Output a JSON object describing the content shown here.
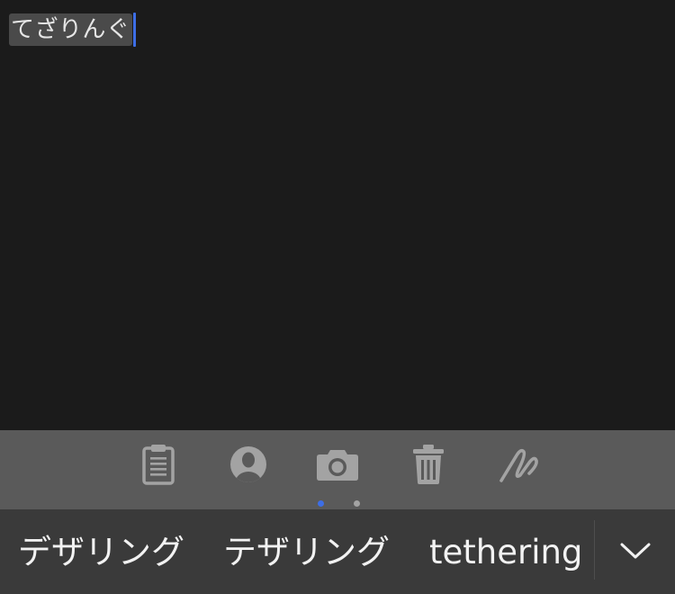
{
  "editor": {
    "composing_text": "てざりんぐ"
  },
  "toolbar": {
    "icons": [
      "clipboard-icon",
      "contact-icon",
      "camera-icon",
      "trash-icon",
      "handwriting-icon"
    ],
    "page_count": 2,
    "active_page": 1
  },
  "candidates": {
    "items": [
      "デザリング",
      "テザリング",
      "tethering"
    ],
    "expand_icon": "chevron-down-icon"
  },
  "colors": {
    "background": "#1b1b1b",
    "composing_highlight": "#4a4a4a",
    "caret": "#3d6ee6",
    "toolbar": "#5a5a5a",
    "toolbar_icon": "#a3a3a3",
    "candidate_bar": "#3a3a3a",
    "active_dot": "#3d6ee6",
    "inactive_dot": "#a3a3a3"
  }
}
